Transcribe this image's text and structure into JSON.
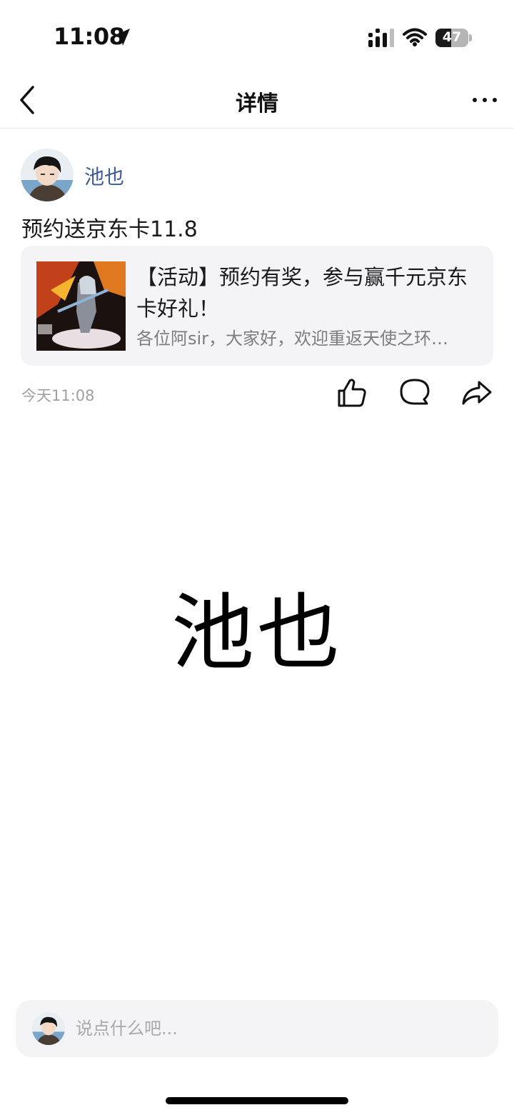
{
  "status_bar": {
    "time": "11:08",
    "battery_level": "47",
    "battery_fraction": 0.47,
    "icons": [
      "location-arrow-icon",
      "cellular-signal-icon",
      "wifi-icon",
      "battery-icon"
    ]
  },
  "nav": {
    "title": "详情",
    "back_icon": "chevron-left-icon",
    "more_icon": "ellipsis-icon"
  },
  "post": {
    "author": "池也",
    "text": "预约送京东卡11.8",
    "time": "今天11:08",
    "link_card": {
      "title": "【活动】预约有奖，参与赢千元京东卡好礼！",
      "description": "各位阿sir，大家好，欢迎重返天使之环…"
    },
    "actions": [
      "thumbs-up-icon",
      "comment-icon",
      "share-icon"
    ]
  },
  "content": {
    "display_name": "池也"
  },
  "comment_bar": {
    "placeholder": "说点什么吧..."
  },
  "colors": {
    "author_name": "#3f5a9a",
    "card_background": "#f4f4f6",
    "muted_text": "#a0a0a0"
  }
}
